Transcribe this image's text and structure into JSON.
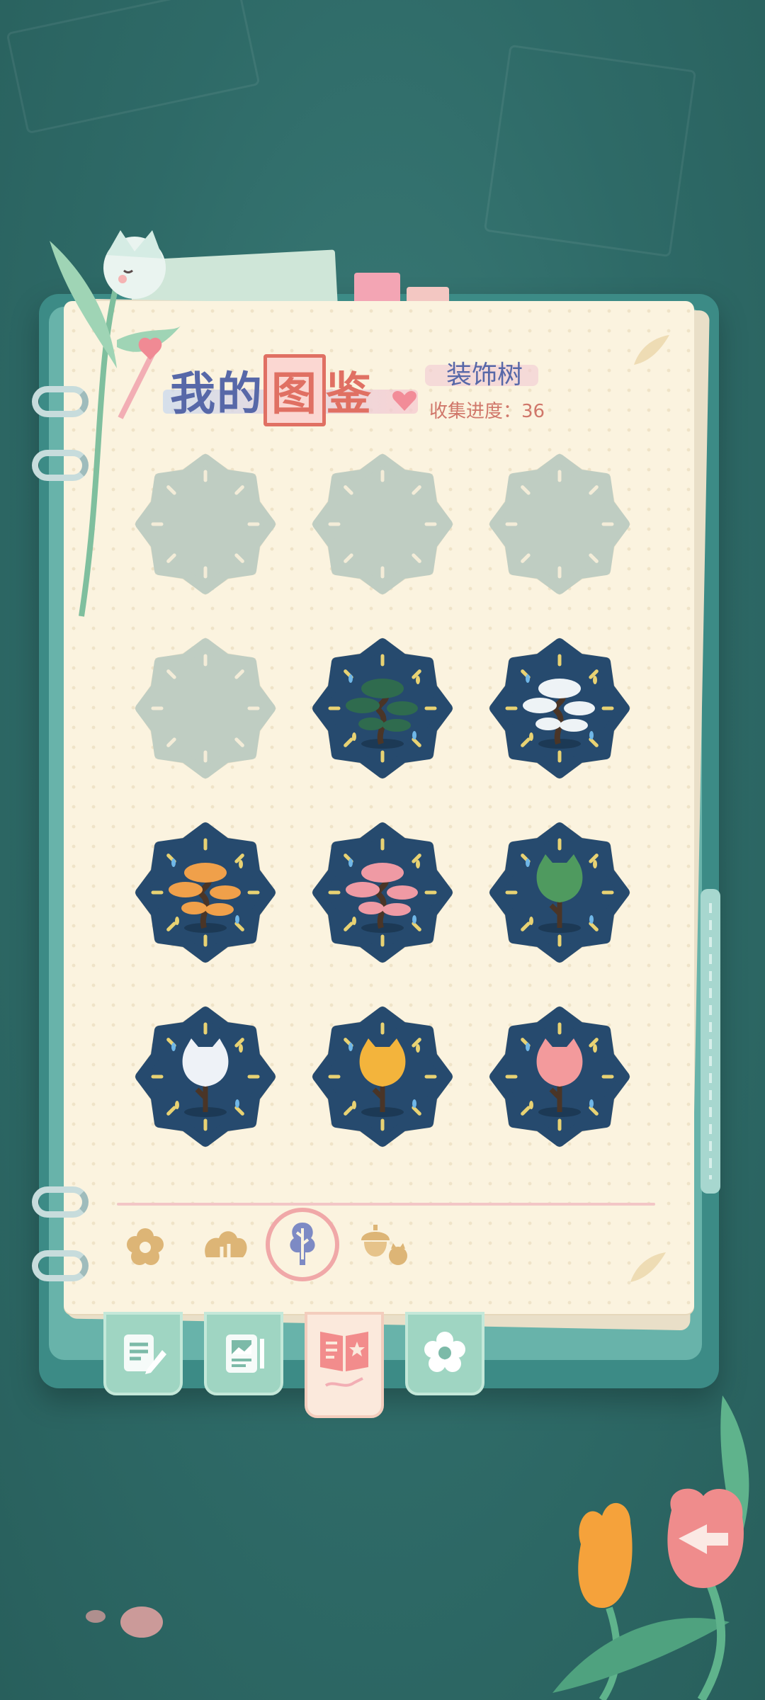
{
  "header": {
    "title_prefix": "我的",
    "title_boxed": "图",
    "title_suffix": "鉴",
    "category": "装饰树",
    "progress_label": "收集进度：36"
  },
  "colors": {
    "background": "#2f6f6c",
    "page": "#fbf3df",
    "badge_locked": "#bfcdc2",
    "badge_unlocked": "#264a6e",
    "title_blue": "#5768a8",
    "accent_red": "#e07063"
  },
  "collection": {
    "items": [
      {
        "name": "locked-slot",
        "state": "locked",
        "icon": "empty-slot"
      },
      {
        "name": "locked-slot",
        "state": "locked",
        "icon": "empty-slot"
      },
      {
        "name": "locked-slot",
        "state": "locked",
        "icon": "empty-slot"
      },
      {
        "name": "locked-slot",
        "state": "locked",
        "icon": "empty-slot"
      },
      {
        "name": "green-pine-bonsai",
        "state": "unlocked",
        "icon": "pine-bonsai-icon",
        "foliage": "#2f6b4e"
      },
      {
        "name": "snow-pine-bonsai",
        "state": "unlocked",
        "icon": "pine-bonsai-icon",
        "foliage": "#eef3f6"
      },
      {
        "name": "orange-pine-bonsai",
        "state": "unlocked",
        "icon": "pine-bonsai-icon",
        "foliage": "#f0a04a"
      },
      {
        "name": "pink-pine-bonsai",
        "state": "unlocked",
        "icon": "pine-bonsai-icon",
        "foliage": "#ef9aa4"
      },
      {
        "name": "green-cat-tree",
        "state": "unlocked",
        "icon": "cat-tree-icon",
        "foliage": "#4f9a5f"
      },
      {
        "name": "white-cat-tree",
        "state": "unlocked",
        "icon": "cat-tree-icon",
        "foliage": "#eef2f7"
      },
      {
        "name": "yellow-cat-tree",
        "state": "unlocked",
        "icon": "cat-tree-icon",
        "foliage": "#f3b43c"
      },
      {
        "name": "pink-cat-tree",
        "state": "unlocked",
        "icon": "cat-tree-icon",
        "foliage": "#f39a9c"
      }
    ]
  },
  "category_tabs": [
    {
      "icon": "flower-icon",
      "active": false
    },
    {
      "icon": "bush-icon",
      "active": false
    },
    {
      "icon": "tree-icon",
      "active": true
    },
    {
      "icon": "acorn-icon",
      "active": false
    }
  ],
  "book_tabs": [
    {
      "icon": "notes-pen-icon",
      "active": false
    },
    {
      "icon": "photo-album-icon",
      "active": false
    },
    {
      "icon": "collection-book-icon",
      "active": true
    },
    {
      "icon": "flower-badge-icon",
      "active": false
    }
  ],
  "back_button_icon": "back-arrow-icon"
}
